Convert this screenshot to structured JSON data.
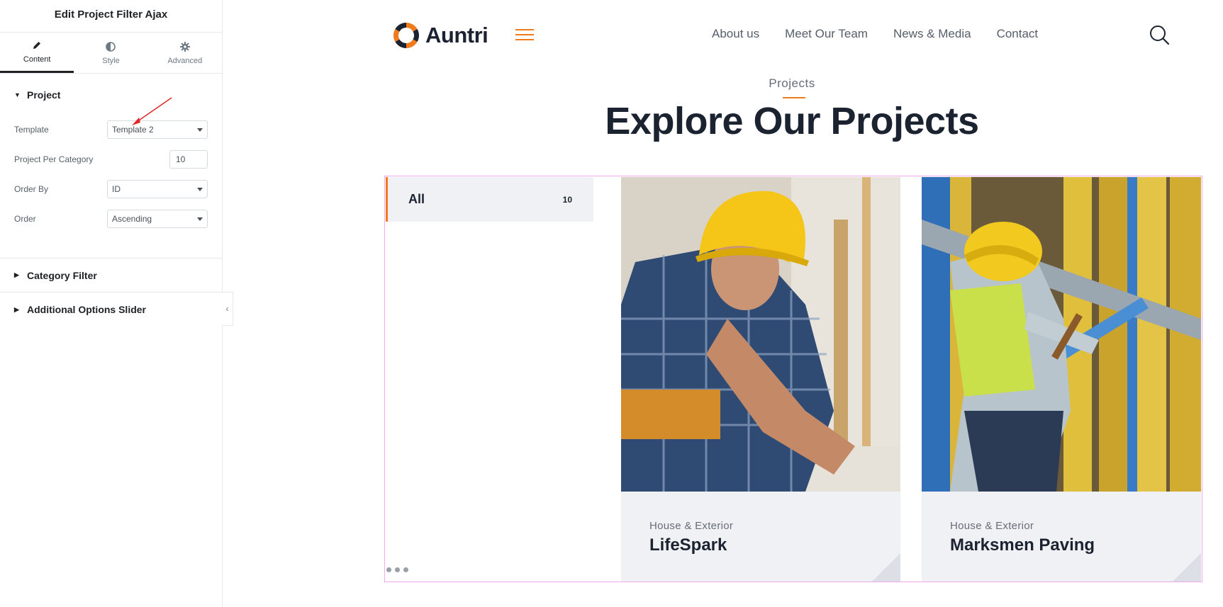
{
  "panel": {
    "title": "Edit Project Filter Ajax",
    "tabs": [
      {
        "label": "Content",
        "icon": "pencil-icon",
        "active": true
      },
      {
        "label": "Style",
        "icon": "half-circle-icon",
        "active": false
      },
      {
        "label": "Advanced",
        "icon": "gear-icon",
        "active": false
      }
    ],
    "project_section": {
      "title": "Project",
      "controls": {
        "template": {
          "label": "Template",
          "value": "Template 2"
        },
        "per_category": {
          "label": "Project Per Category",
          "value": "10"
        },
        "order_by": {
          "label": "Order By",
          "value": "ID"
        },
        "order": {
          "label": "Order",
          "value": "Ascending"
        }
      }
    },
    "sections": [
      {
        "title": "Category Filter"
      },
      {
        "title": "Additional Options Slider"
      }
    ]
  },
  "site": {
    "logo_text": "Auntri",
    "nav": [
      "About us",
      "Meet Our Team",
      "News & Media",
      "Contact"
    ],
    "eyebrow": "Projects",
    "title": "Explore Our Projects",
    "filter": {
      "label": "All",
      "count": "10"
    },
    "projects": [
      {
        "category": "House & Exterior",
        "name": "LifeSpark"
      },
      {
        "category": "House & Exterior",
        "name": "Marksmen Paving"
      }
    ],
    "colors": {
      "accent": "#f07b1d",
      "dark": "#1b2331",
      "widget_outline": "#f0a9ea",
      "card_bg": "#f0f1f4"
    }
  }
}
